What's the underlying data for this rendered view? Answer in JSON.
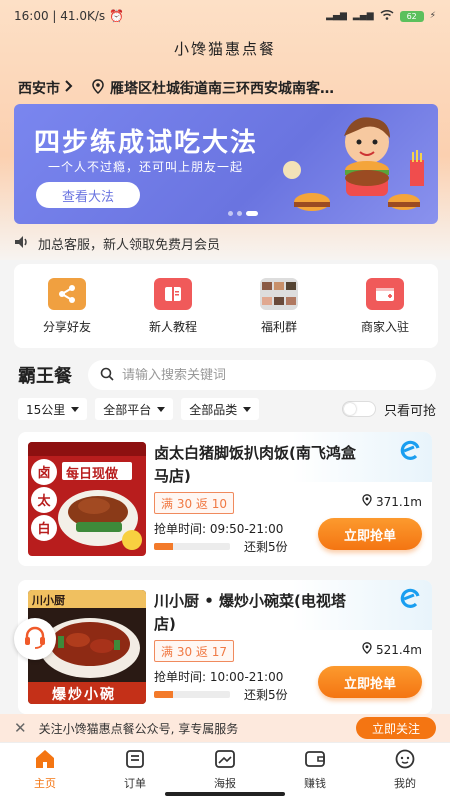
{
  "status_bar": {
    "time": "16:00",
    "speed": "41.0K/s",
    "battery": "62"
  },
  "app": {
    "title": "小馋猫惠点餐"
  },
  "location": {
    "city": "西安市",
    "address": "雁塔区杜城街道南三环西安城南客…"
  },
  "banner": {
    "title": "四步练成试吃大法",
    "subtitle": "一个人不过瘾，还可叫上朋友一起",
    "button_label": "查看大法",
    "bg_color": "#7a86ef"
  },
  "notice": {
    "text": "加总客服，新人领取免费月会员"
  },
  "shortcuts": [
    {
      "label": "分享好友",
      "icon": "share-icon"
    },
    {
      "label": "新人教程",
      "icon": "book-icon"
    },
    {
      "label": "福利群",
      "icon": "group-avatars-icon"
    },
    {
      "label": "商家入驻",
      "icon": "merchant-icon"
    }
  ],
  "section": {
    "title": "霸王餐",
    "search_placeholder": "请输入搜索关键词"
  },
  "filters": [
    {
      "label": "15公里"
    },
    {
      "label": "全部平台"
    },
    {
      "label": "全部品类"
    }
  ],
  "toggle_label": "只看可抢",
  "cards": [
    {
      "name": "卤太白猪脚饭扒肉饭(南飞鸿盒马店)",
      "promo": "满 30 返 10",
      "distance": "371.1m",
      "grab_time": "抢单时间: 09:50-21:00",
      "remaining": "还剩5份",
      "progress": 0.25,
      "button_label": "立即抢单",
      "image_text": "卤太白",
      "image_badge": "每日现做"
    },
    {
      "name": "川小厨 • 爆炒小碗菜(电视塔店)",
      "promo": "满 30 返 17",
      "distance": "521.4m",
      "grab_time": "抢单时间: 10:00-21:00",
      "remaining": "还剩5份",
      "progress": 0.25,
      "button_label": "立即抢单",
      "image_text": "爆炒小碗",
      "image_badge": "川小厨"
    }
  ],
  "follow_bar": {
    "text": "关注小馋猫惠点餐公众号, 享专属服务",
    "button_label": "立即关注"
  },
  "tabbar": [
    {
      "label": "主页",
      "icon": "home-icon",
      "active": true
    },
    {
      "label": "订单",
      "icon": "order-icon",
      "active": false
    },
    {
      "label": "海报",
      "icon": "poster-icon",
      "active": false
    },
    {
      "label": "赚钱",
      "icon": "wallet-icon",
      "active": false
    },
    {
      "label": "我的",
      "icon": "profile-icon",
      "active": false
    }
  ],
  "colors": {
    "accent": "#f47512",
    "banner": "#7a86ef",
    "promo": "#f07a45"
  }
}
